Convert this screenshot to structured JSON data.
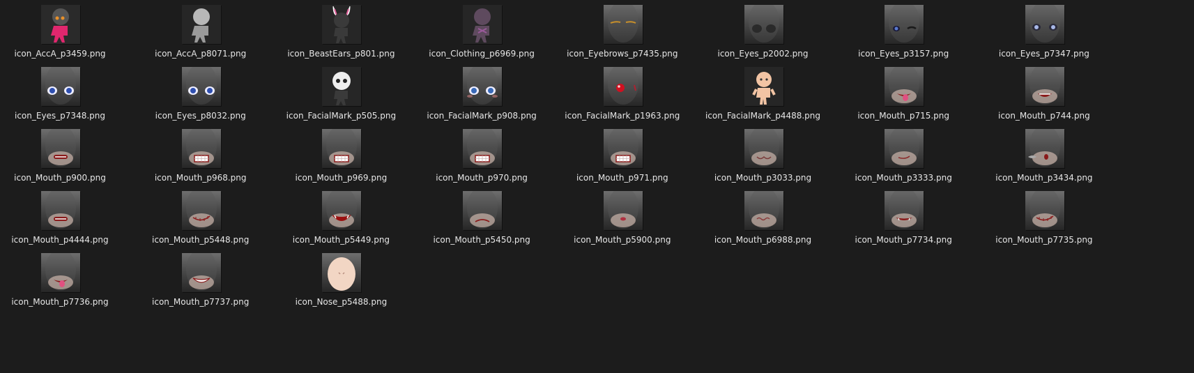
{
  "files": [
    {
      "name": "icon_AccA_p3459.png",
      "icon": "chibi-figure-pink-icon"
    },
    {
      "name": "icon_AccA_p8071.png",
      "icon": "chibi-figure-gray-icon"
    },
    {
      "name": "icon_BeastEars_p801.png",
      "icon": "bunny-ears-icon"
    },
    {
      "name": "icon_Clothing_p6969.png",
      "icon": "clothing-figure-icon"
    },
    {
      "name": "icon_Eyebrows_p7435.png",
      "icon": "eyebrows-icon"
    },
    {
      "name": "icon_Eyes_p2002.png",
      "icon": "shadow-eyes-icon"
    },
    {
      "name": "icon_Eyes_p3157.png",
      "icon": "wink-eyes-icon"
    },
    {
      "name": "icon_Eyes_p7347.png",
      "icon": "pale-eyes-icon"
    },
    {
      "name": "icon_Eyes_p7348.png",
      "icon": "blue-eyes-icon"
    },
    {
      "name": "icon_Eyes_p8032.png",
      "icon": "blue-eyes-icon"
    },
    {
      "name": "icon_FacialMark_p505.png",
      "icon": "skull-mask-icon"
    },
    {
      "name": "icon_FacialMark_p908.png",
      "icon": "blush-eyes-icon"
    },
    {
      "name": "icon_FacialMark_p1963.png",
      "icon": "red-nose-icon"
    },
    {
      "name": "icon_FacialMark_p4488.png",
      "icon": "baby-doll-icon"
    },
    {
      "name": "icon_Mouth_p715.png",
      "icon": "mouth-tongue-icon"
    },
    {
      "name": "icon_Mouth_p744.png",
      "icon": "mouth-open-icon"
    },
    {
      "name": "icon_Mouth_p900.png",
      "icon": "mouth-grimace-icon"
    },
    {
      "name": "icon_Mouth_p968.png",
      "icon": "mouth-teeth-icon"
    },
    {
      "name": "icon_Mouth_p969.png",
      "icon": "mouth-teeth-icon"
    },
    {
      "name": "icon_Mouth_p970.png",
      "icon": "mouth-teeth-icon"
    },
    {
      "name": "icon_Mouth_p971.png",
      "icon": "mouth-teeth-icon"
    },
    {
      "name": "icon_Mouth_p3033.png",
      "icon": "mouth-cat-icon"
    },
    {
      "name": "icon_Mouth_p3333.png",
      "icon": "mouth-smirk-icon"
    },
    {
      "name": "icon_Mouth_p3434.png",
      "icon": "mouth-sigh-icon"
    },
    {
      "name": "icon_Mouth_p4444.png",
      "icon": "mouth-grimace-icon"
    },
    {
      "name": "icon_Mouth_p5448.png",
      "icon": "mouth-stitched-icon"
    },
    {
      "name": "icon_Mouth_p5449.png",
      "icon": "mouth-fang-icon"
    },
    {
      "name": "icon_Mouth_p5450.png",
      "icon": "mouth-frown-icon"
    },
    {
      "name": "icon_Mouth_p5900.png",
      "icon": "mouth-small-icon"
    },
    {
      "name": "icon_Mouth_p6988.png",
      "icon": "mouth-wavy-icon"
    },
    {
      "name": "icon_Mouth_p7734.png",
      "icon": "mouth-fang-smile-icon"
    },
    {
      "name": "icon_Mouth_p7735.png",
      "icon": "mouth-stitched-icon"
    },
    {
      "name": "icon_Mouth_p7736.png",
      "icon": "mouth-tongue-icon"
    },
    {
      "name": "icon_Mouth_p7737.png",
      "icon": "mouth-grin-icon"
    },
    {
      "name": "icon_Nose_p5488.png",
      "icon": "nose-face-icon"
    }
  ]
}
